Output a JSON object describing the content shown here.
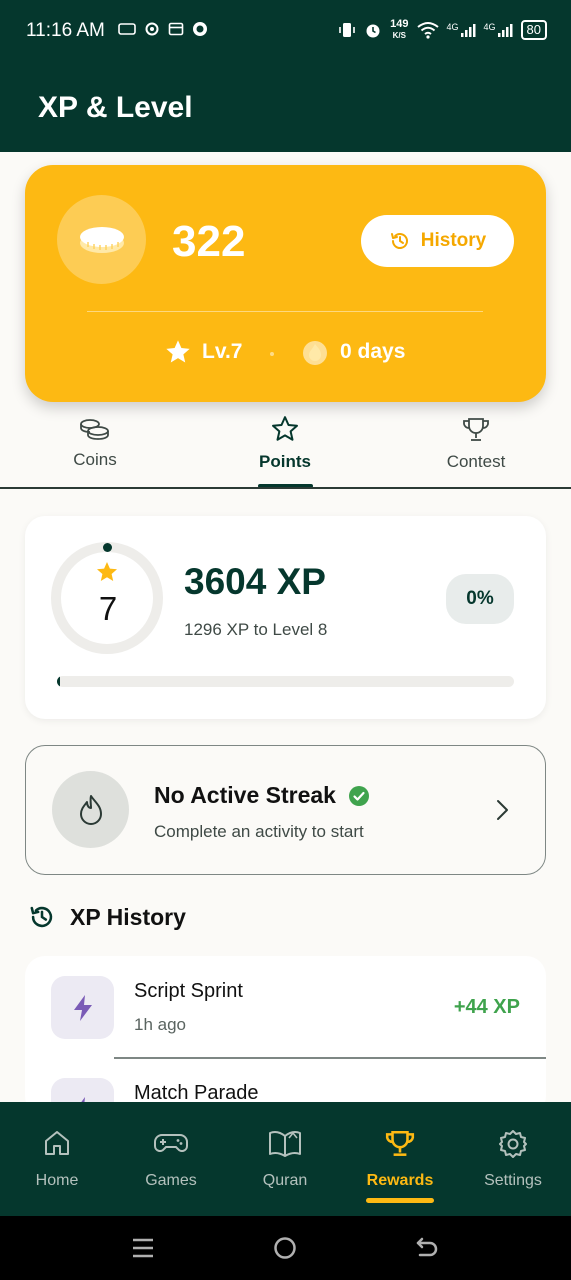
{
  "status_bar": {
    "time": "11:16 AM",
    "net_speed_value": "149",
    "net_speed_unit": "K/S",
    "signal_1": "4G",
    "signal_2": "4G",
    "battery": "80"
  },
  "header": {
    "title": "XP & Level"
  },
  "summary_card": {
    "coins": "322",
    "history_label": "History",
    "level_label": "Lv.7",
    "streak_label": "0 days",
    "accent": "#FDB913"
  },
  "tabs": [
    {
      "label": "Coins",
      "icon": "coins-icon",
      "active": false
    },
    {
      "label": "Points",
      "icon": "star-outline-icon",
      "active": true
    },
    {
      "label": "Contest",
      "icon": "trophy-icon",
      "active": false
    }
  ],
  "xp_card": {
    "level": "7",
    "xp_total": "3604 XP",
    "xp_to_next": "1296 XP to Level 8",
    "percent_label": "0%",
    "progress_fraction": 0.0
  },
  "streak_card": {
    "title": "No Active Streak",
    "subtitle": "Complete an activity to start"
  },
  "xp_history": {
    "heading": "XP History",
    "items": [
      {
        "name": "Script Sprint",
        "time": "1h ago",
        "xp": "+44 XP",
        "icon": "lightning-icon"
      },
      {
        "name": "Match Parade",
        "time": "",
        "xp": "",
        "icon": "lightning-icon"
      }
    ]
  },
  "bottom_nav": [
    {
      "label": "Home",
      "icon": "home-icon",
      "active": false
    },
    {
      "label": "Games",
      "icon": "gamepad-icon",
      "active": false
    },
    {
      "label": "Quran",
      "icon": "book-icon",
      "active": false
    },
    {
      "label": "Rewards",
      "icon": "trophy-icon",
      "active": true
    },
    {
      "label": "Settings",
      "icon": "gear-icon",
      "active": false
    }
  ],
  "colors": {
    "primary": "#05372D",
    "accent": "#FDB913",
    "success": "#3FA34D"
  }
}
